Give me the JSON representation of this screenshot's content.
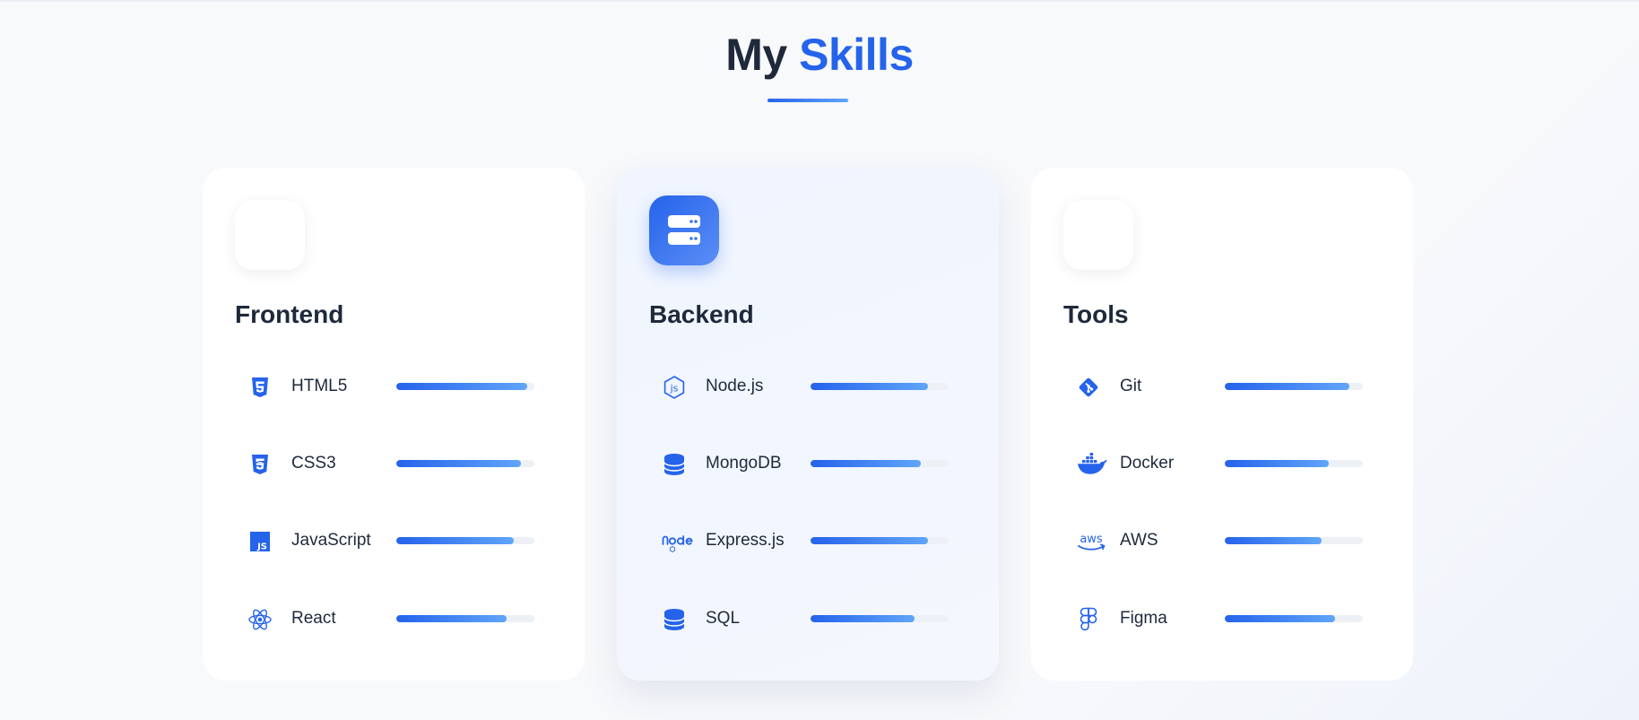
{
  "section": {
    "title_part1": "My",
    "title_part2": "Skills"
  },
  "colors": {
    "accent": "#2563eb",
    "accent_light": "#60a5fa",
    "text_dark": "#1e293b",
    "track": "#edf0f4"
  },
  "cards": [
    {
      "title": "Frontend",
      "header_icon": "code-icon",
      "skills": [
        {
          "name": "HTML5",
          "icon": "html5-icon",
          "level": 0.95
        },
        {
          "name": "CSS3",
          "icon": "css3-icon",
          "level": 0.9
        },
        {
          "name": "JavaScript",
          "icon": "javascript-icon",
          "level": 0.85
        },
        {
          "name": "React",
          "icon": "react-icon",
          "level": 0.8
        }
      ]
    },
    {
      "title": "Backend",
      "header_icon": "server-icon",
      "skills": [
        {
          "name": "Node.js",
          "icon": "nodejs-icon",
          "level": 0.85
        },
        {
          "name": "MongoDB",
          "icon": "database-icon",
          "level": 0.8
        },
        {
          "name": "Express.js",
          "icon": "node-logo-icon",
          "level": 0.85
        },
        {
          "name": "SQL",
          "icon": "database-icon",
          "level": 0.75
        }
      ]
    },
    {
      "title": "Tools",
      "header_icon": "tools-icon",
      "skills": [
        {
          "name": "Git",
          "icon": "git-icon",
          "level": 0.9
        },
        {
          "name": "Docker",
          "icon": "docker-icon",
          "level": 0.75
        },
        {
          "name": "AWS",
          "icon": "aws-icon",
          "level": 0.7
        },
        {
          "name": "Figma",
          "icon": "figma-icon",
          "level": 0.8
        }
      ]
    }
  ]
}
